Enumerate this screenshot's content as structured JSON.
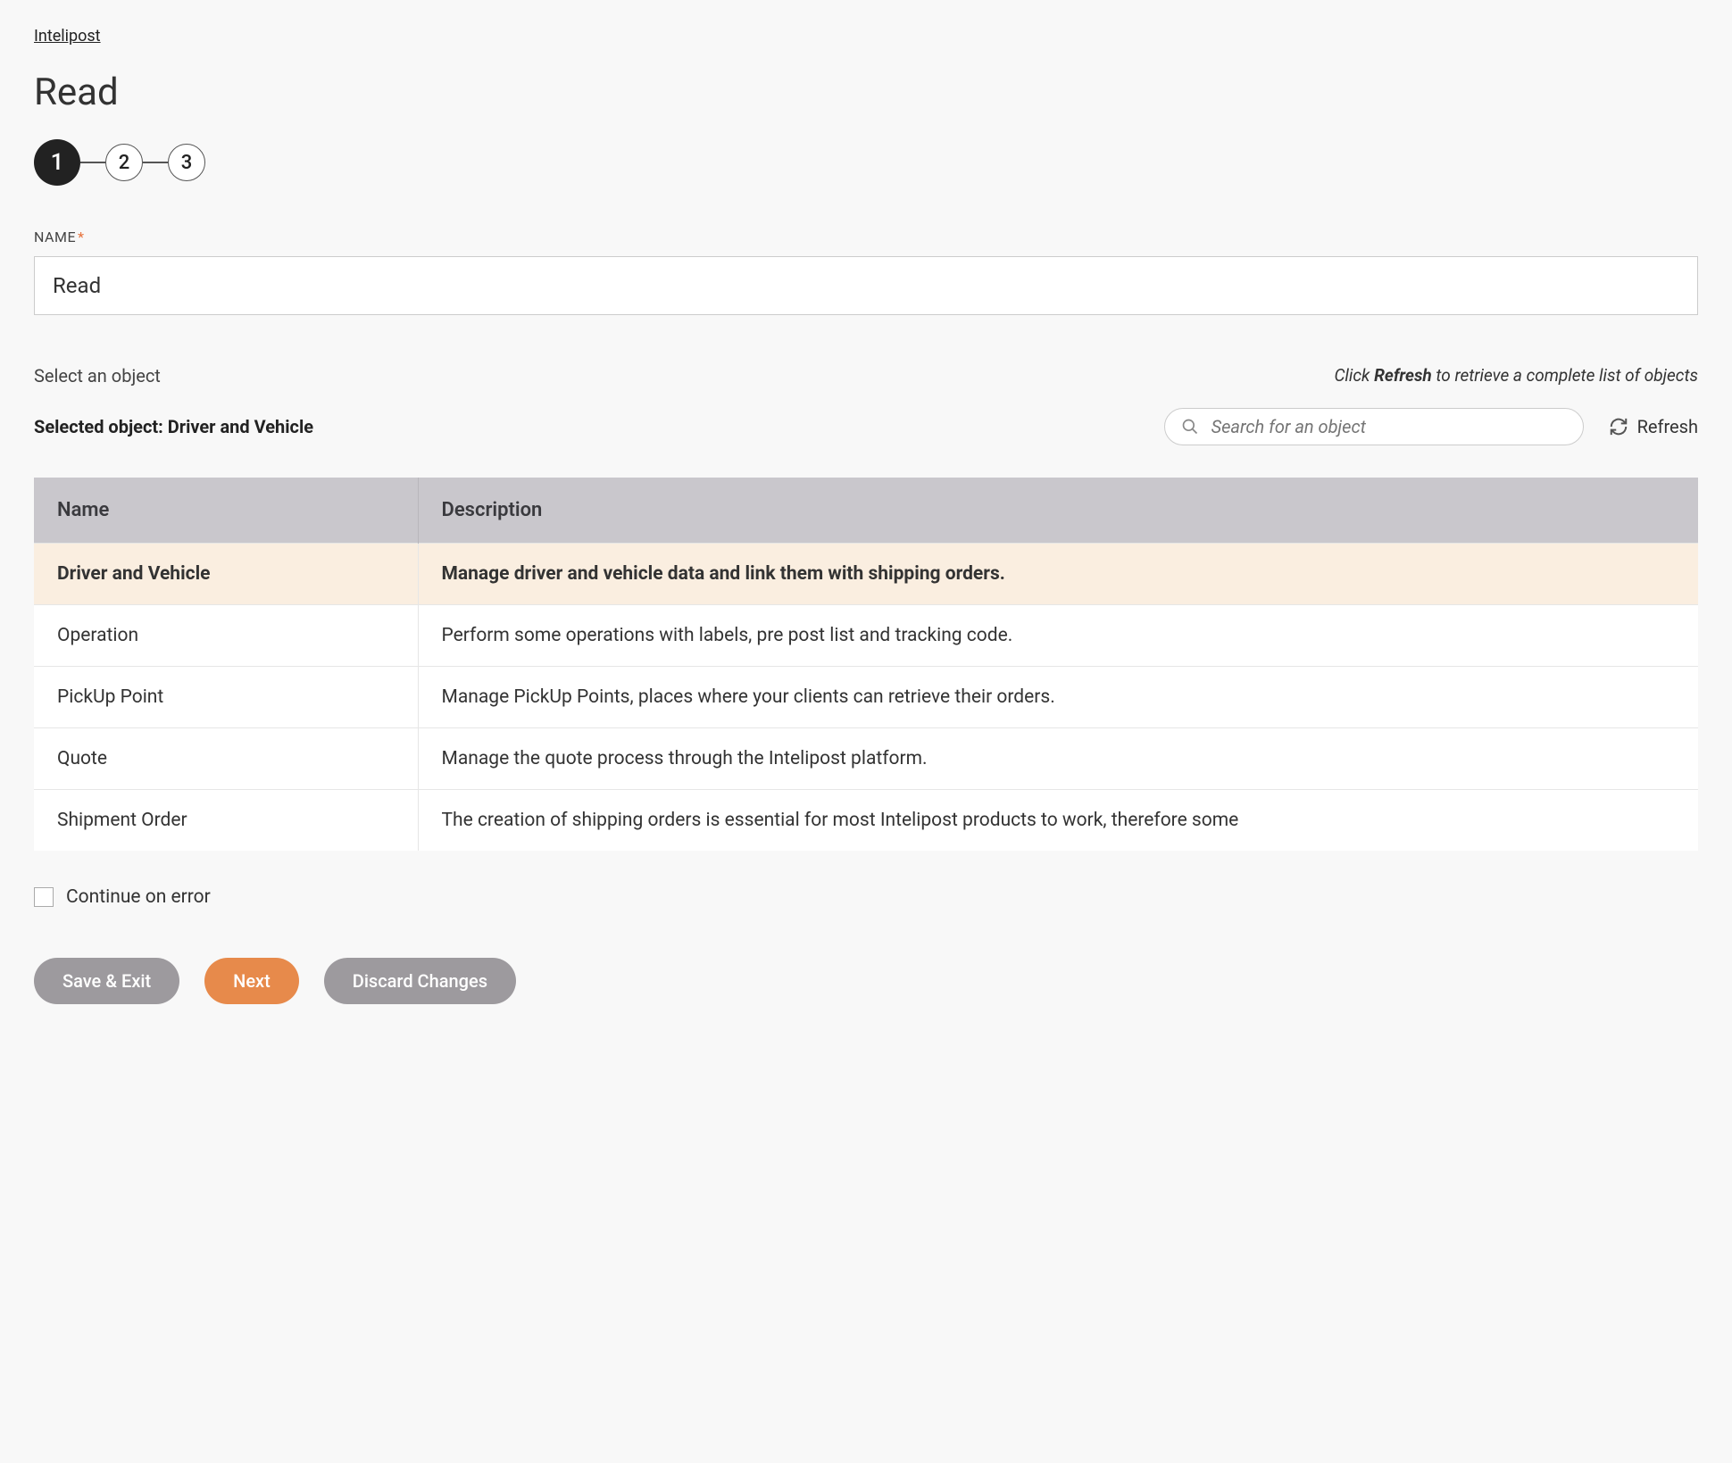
{
  "breadcrumb": "Intelipost",
  "page_title": "Read",
  "stepper": {
    "steps": [
      "1",
      "2",
      "3"
    ],
    "active": 0
  },
  "name_field": {
    "label": "NAME",
    "value": "Read"
  },
  "select_object_label": "Select an object",
  "refresh_hint_prefix": "Click ",
  "refresh_hint_bold": "Refresh",
  "refresh_hint_suffix": " to retrieve a complete list of objects",
  "selected_object_prefix": "Selected object: ",
  "selected_object_value": "Driver and Vehicle",
  "search": {
    "placeholder": "Search for an object"
  },
  "refresh_button": "Refresh",
  "table": {
    "headers": {
      "name": "Name",
      "description": "Description"
    },
    "rows": [
      {
        "name": "Driver and Vehicle",
        "description": "Manage driver and vehicle data and link them with shipping orders.",
        "selected": true
      },
      {
        "name": "Operation",
        "description": "Perform some operations with labels, pre post list and tracking code.",
        "selected": false
      },
      {
        "name": "PickUp Point",
        "description": "Manage PickUp Points, places where your clients can retrieve their orders.",
        "selected": false
      },
      {
        "name": "Quote",
        "description": "Manage the quote process through the Intelipost platform.",
        "selected": false
      },
      {
        "name": "Shipment Order",
        "description": "The creation of shipping orders is essential for most Intelipost products to work, therefore some",
        "selected": false
      }
    ]
  },
  "continue_on_error_label": "Continue on error",
  "buttons": {
    "save_exit": "Save & Exit",
    "next": "Next",
    "discard": "Discard Changes"
  }
}
